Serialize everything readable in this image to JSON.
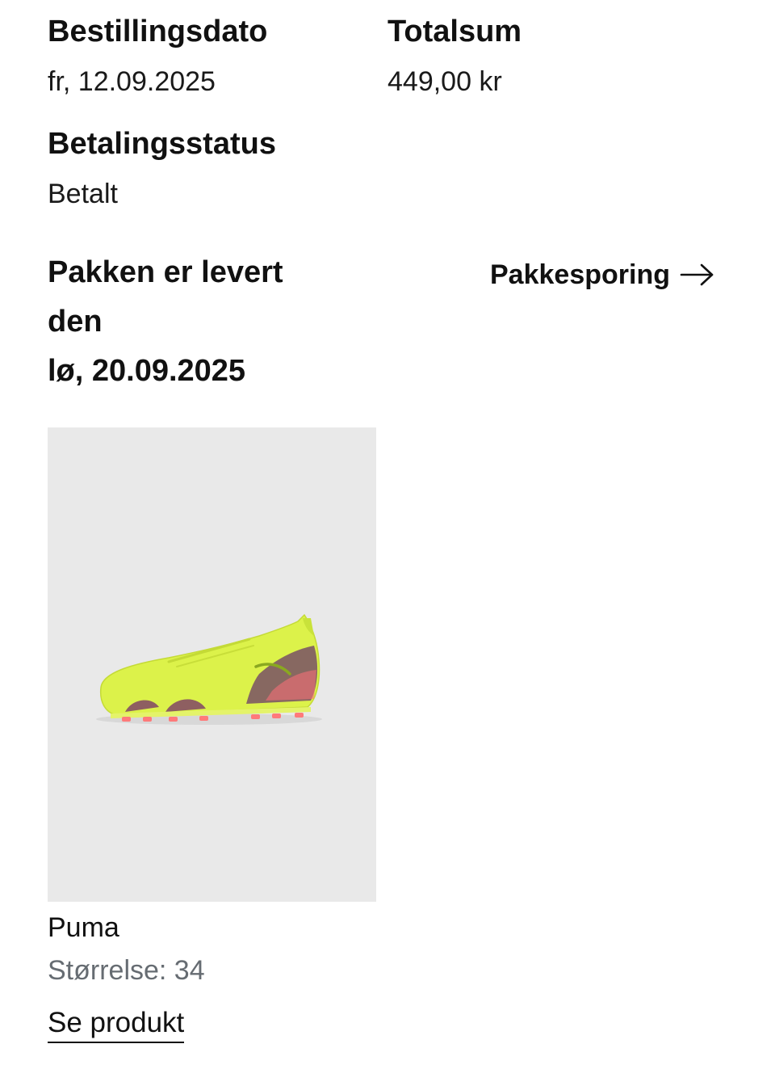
{
  "order": {
    "date_label": "Bestillingsdato",
    "date_value": "fr, 12.09.2025",
    "total_label": "Totalsum",
    "total_value": "449,00 kr",
    "payment_label": "Betalingsstatus",
    "payment_value": "Betalt"
  },
  "delivery": {
    "line1": "Pakken er levert",
    "line2": "den",
    "line3": "lø, 20.09.2025",
    "tracking_label": "Pakkesporing",
    "tracking_icon": "arrow-right-icon"
  },
  "product": {
    "image_icon": "football-boot-image",
    "image_bg_color": "#e9e9e9",
    "shoe_color": "#dcf24a",
    "accent_color": "#ff6f7a",
    "brand": "Puma",
    "size_text": "Størrelse: 34",
    "link_label": "Se produkt"
  }
}
